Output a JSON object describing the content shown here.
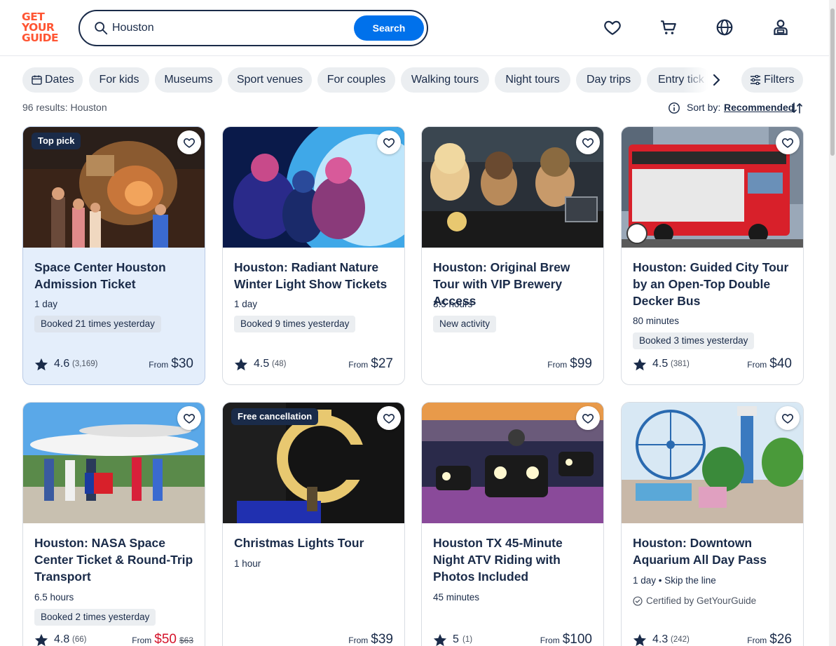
{
  "header": {
    "logo": [
      "GET",
      "YOUR",
      "GUIDE"
    ],
    "search": {
      "value": "Houston",
      "button_label": "Search"
    },
    "icons": [
      "heart-icon",
      "cart-icon",
      "globe-icon",
      "user-icon"
    ]
  },
  "chips": [
    "Dates",
    "For kids",
    "Museums",
    "Sport venues",
    "For couples",
    "Walking tours",
    "Night tours",
    "Day trips",
    "Entry tick"
  ],
  "filters_label": "Filters",
  "results_text": "96 results: Houston",
  "sort": {
    "label": "Sort by:",
    "value": "Recommended"
  },
  "cards": [
    {
      "tag": "Top pick",
      "title": "Space Center Houston Admission Ticket",
      "meta": "1 day",
      "badge": "Booked 21 times yesterday",
      "rating": "4.6",
      "reviews": "(3,169)",
      "from": "From",
      "price": "$30"
    },
    {
      "title": "Houston: Radiant Nature Winter Light Show Tickets",
      "meta": "1 day",
      "badge": "Booked 9 times yesterday",
      "rating": "4.5",
      "reviews": "(48)",
      "from": "From",
      "price": "$27"
    },
    {
      "title": "Houston: Original Brew Tour with VIP Brewery Access",
      "meta": "3.5 hours",
      "badge": "New activity",
      "from": "From",
      "price": "$99"
    },
    {
      "title": "Houston: Guided City Tour by an Open-Top Double Decker Bus",
      "meta": "80 minutes",
      "badge": "Booked 3 times yesterday",
      "rating": "4.5",
      "reviews": "(381)",
      "from": "From",
      "price": "$40"
    },
    {
      "title": "Houston: NASA Space Center Ticket & Round-Trip Transport",
      "meta": "6.5 hours",
      "badge": "Booked 2 times yesterday",
      "rating": "4.8",
      "reviews": "(66)",
      "from": "From",
      "price": "$50",
      "old_price": "$63"
    },
    {
      "tag": "Free cancellation",
      "title": "Christmas Lights Tour",
      "meta": "1 hour",
      "from": "From",
      "price": "$39"
    },
    {
      "title": "Houston TX 45-Minute Night ATV Riding with Photos Included",
      "meta": "45 minutes",
      "rating": "5",
      "reviews": "(1)",
      "from": "From",
      "price": "$100"
    },
    {
      "title": "Houston: Downtown Aquarium All Day Pass",
      "meta": "1 day • Skip the line",
      "certified": "Certified by GetYourGuide",
      "rating": "4.3",
      "reviews": "(242)",
      "from": "From",
      "price": "$26"
    }
  ],
  "colors": {
    "accent": "#0071eb",
    "brand": "#ff5533",
    "text": "#1a2b49",
    "sale": "#d4132a",
    "highlight": "#e4eefb"
  }
}
